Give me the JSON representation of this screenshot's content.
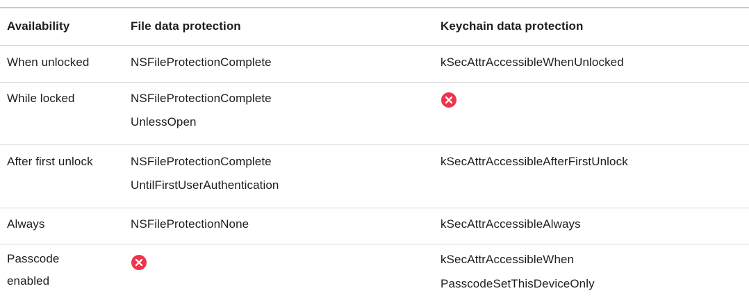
{
  "colors": {
    "text": "#1d1d1f",
    "rule": "#d9d9dc",
    "not_available": "#f0334a"
  },
  "table": {
    "headers": {
      "availability": "Availability",
      "file": "File data protection",
      "keychain": "Keychain data protection"
    },
    "rows": [
      {
        "availability": [
          "When unlocked"
        ],
        "file": [
          "NSFileProtectionComplete"
        ],
        "keychain": [
          "kSecAttrAccessibleWhenUnlocked"
        ]
      },
      {
        "availability": [
          "While locked"
        ],
        "file": [
          "NSFileProtectionComplete",
          "UnlessOpen"
        ],
        "keychain_icon": "x-circle-icon"
      },
      {
        "availability": [
          "After first unlock"
        ],
        "file": [
          "NSFileProtectionComplete",
          "UntilFirstUserAuthentication"
        ],
        "keychain": [
          "kSecAttrAccessibleAfterFirstUnlock"
        ]
      },
      {
        "availability": [
          "Always"
        ],
        "file": [
          "NSFileProtectionNone"
        ],
        "keychain": [
          "kSecAttrAccessibleAlways"
        ]
      },
      {
        "availability": [
          "Passcode",
          "enabled"
        ],
        "file_icon": "x-circle-icon",
        "keychain": [
          "kSecAttrAccessibleWhen",
          "PasscodeSetThisDeviceOnly"
        ]
      }
    ]
  }
}
